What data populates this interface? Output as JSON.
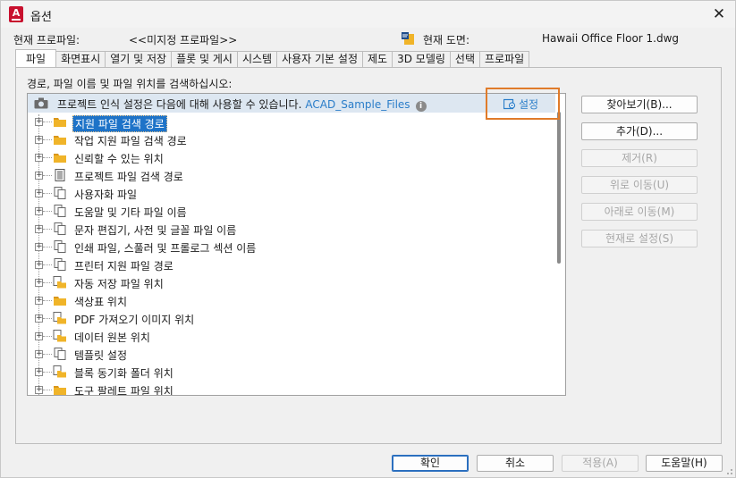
{
  "window": {
    "title": "옵션",
    "app_icon_letter": "A",
    "close_symbol": "✕"
  },
  "profile": {
    "current_profile_label": "현재 프로파일:",
    "current_profile_value": "<<미지정 프로파일>>",
    "current_drawing_label": "현재 도면:",
    "current_drawing_value": "Hawaii Office Floor 1.dwg"
  },
  "tabs": [
    {
      "label": "파일",
      "active": true
    },
    {
      "label": "화면표시"
    },
    {
      "label": "열기 및 저장"
    },
    {
      "label": "플롯 및 게시"
    },
    {
      "label": "시스템"
    },
    {
      "label": "사용자 기본 설정"
    },
    {
      "label": "제도"
    },
    {
      "label": "3D 모델링"
    },
    {
      "label": "선택"
    },
    {
      "label": "프로파일"
    }
  ],
  "files_tab": {
    "prompt": "경로, 파일 이름 및 파일 위치를 검색하십시오:",
    "project_header": {
      "text": "프로젝트 인식 설정은 다음에 대해 사용할 수 있습니다.",
      "project_file": "ACAD_Sample_Files",
      "info_symbol": "i",
      "settings_link": "설정"
    },
    "tree_items": [
      {
        "label": "지원 파일 검색 경로",
        "icon": "folder-icon",
        "selected": true
      },
      {
        "label": "작업 지원 파일 검색 경로",
        "icon": "folder-icon"
      },
      {
        "label": "신뢰할 수 있는 위치",
        "icon": "folder-icon"
      },
      {
        "label": "프로젝트 파일 검색 경로",
        "icon": "project-file-icon"
      },
      {
        "label": "사용자화 파일",
        "icon": "files-icon"
      },
      {
        "label": "도움말 및 기타 파일 이름",
        "icon": "files-icon"
      },
      {
        "label": "문자 편집기, 사전 및 글꼴 파일 이름",
        "icon": "files-icon"
      },
      {
        "label": "인쇄 파일, 스풀러 및 프롤로그 섹션 이름",
        "icon": "files-icon"
      },
      {
        "label": "프린터 지원 파일 경로",
        "icon": "files-icon"
      },
      {
        "label": "자동 저장 파일 위치",
        "icon": "folder-files-icon"
      },
      {
        "label": "색상표 위치",
        "icon": "folder-icon"
      },
      {
        "label": "PDF 가져오기 이미지 위치",
        "icon": "folder-files-icon"
      },
      {
        "label": "데이터 원본 위치",
        "icon": "folder-files-icon"
      },
      {
        "label": "템플릿 설정",
        "icon": "files-icon"
      },
      {
        "label": "블록 동기화 폴더 위치",
        "icon": "folder-files-icon"
      },
      {
        "label": "도구 팔레트 파일 위치",
        "icon": "folder-icon"
      }
    ],
    "side_buttons": [
      {
        "label": "찾아보기(B)...",
        "enabled": true
      },
      {
        "label": "추가(D)...",
        "enabled": true
      },
      {
        "label": "제거(R)",
        "enabled": false
      },
      {
        "label": "위로 이동(U)",
        "enabled": false
      },
      {
        "label": "아래로 이동(M)",
        "enabled": false
      },
      {
        "label": "현재로 설정(S)",
        "enabled": false
      }
    ]
  },
  "bottom_buttons": {
    "ok": "확인",
    "cancel": "취소",
    "apply": "적용(A)",
    "help": "도움말(H)"
  },
  "colors": {
    "accent": "#1e73c8",
    "link": "#2a7dc9",
    "highlight_box": "#e07b2a",
    "folder": "#f0b429",
    "header_bg": "#dde7f1"
  }
}
